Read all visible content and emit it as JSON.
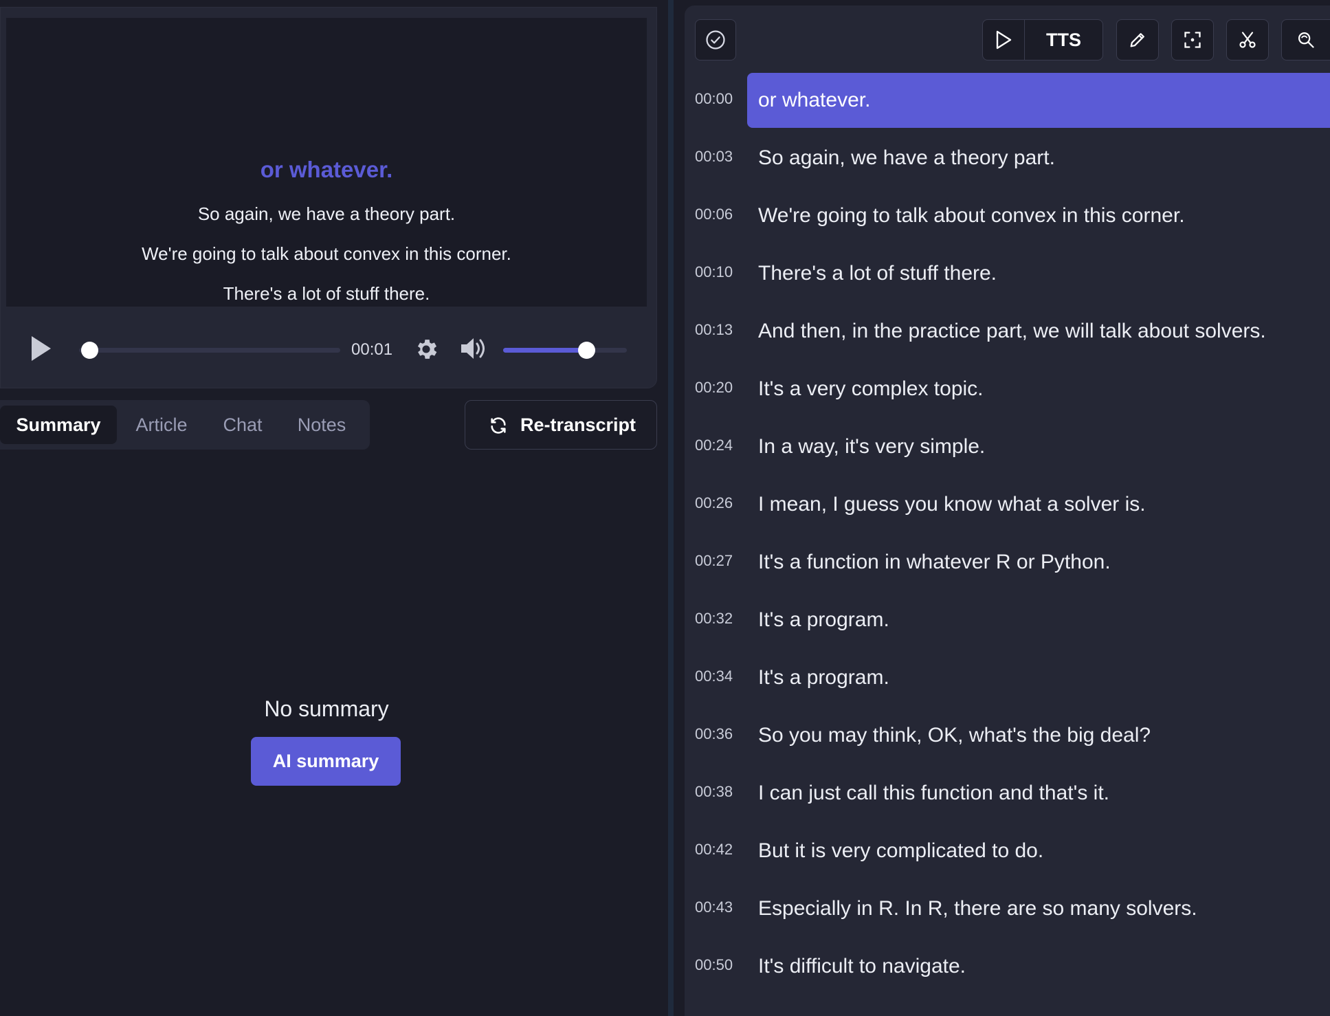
{
  "player": {
    "subtitles": {
      "current": "or whatever.",
      "next": [
        "So again, we have a theory part.",
        "We're going to talk about convex in this corner.",
        "There's a lot of stuff there."
      ]
    },
    "time": "00:01",
    "progress_fraction": 0.04,
    "volume_fraction": 0.67
  },
  "tabs": {
    "summary": "Summary",
    "article": "Article",
    "chat": "Chat",
    "notes": "Notes",
    "active": "summary"
  },
  "retranscript_label": "Re-transcript",
  "summary_panel": {
    "empty_text": "No summary",
    "button_label": "AI summary"
  },
  "toolbar": {
    "tts_label": "TTS",
    "icons": [
      "check-circle-icon",
      "play-icon",
      "pencil-icon",
      "focus-icon",
      "scissors-icon",
      "search-refresh-icon"
    ]
  },
  "transcript": [
    {
      "time": "00:00",
      "text": "or whatever.",
      "active": true
    },
    {
      "time": "00:03",
      "text": "So again, we have a theory part."
    },
    {
      "time": "00:06",
      "text": "We're going to talk about convex in this corner."
    },
    {
      "time": "00:10",
      "text": "There's a lot of stuff there."
    },
    {
      "time": "00:13",
      "text": "And then, in the practice part, we will talk about solvers."
    },
    {
      "time": "00:20",
      "text": "It's a very complex topic."
    },
    {
      "time": "00:24",
      "text": "In a way, it's very simple."
    },
    {
      "time": "00:26",
      "text": "I mean, I guess you know what a solver is."
    },
    {
      "time": "00:27",
      "text": "It's a function in whatever R or Python."
    },
    {
      "time": "00:32",
      "text": "It's a program."
    },
    {
      "time": "00:34",
      "text": "It's a program."
    },
    {
      "time": "00:36",
      "text": "So you may think, OK, what's the big deal?"
    },
    {
      "time": "00:38",
      "text": "I can just call this function and that's it."
    },
    {
      "time": "00:42",
      "text": "But it is very complicated to do."
    },
    {
      "time": "00:43",
      "text": "Especially in R. In R, there are so many solvers."
    },
    {
      "time": "00:50",
      "text": "It's difficult to navigate."
    }
  ],
  "colors": {
    "accent": "#5b5bd6",
    "background": "#1b1c27",
    "panel": "#252735"
  }
}
